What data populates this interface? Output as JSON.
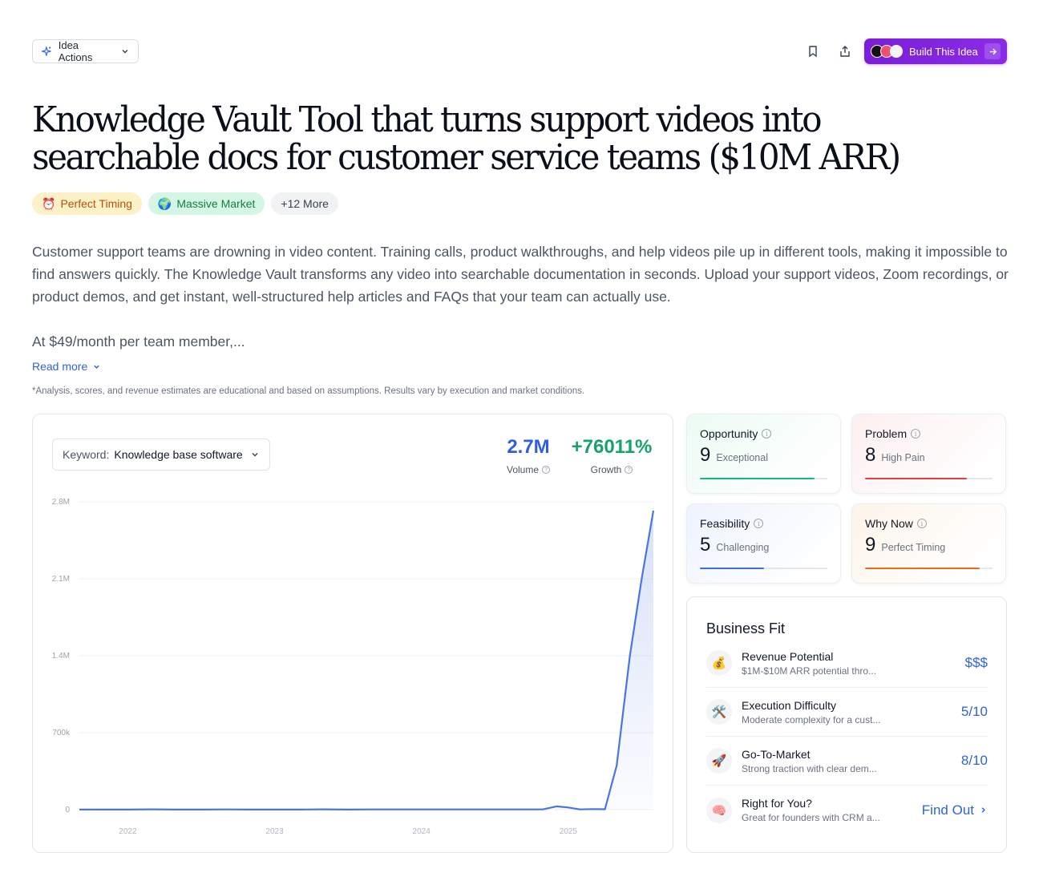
{
  "header": {
    "idea_actions_label": "Idea Actions",
    "build_button_label": "Build This Idea"
  },
  "idea": {
    "title": "Knowledge Vault Tool that turns support videos into searchable docs for customer service teams ($10M ARR)",
    "tags": [
      {
        "emoji": "⏰",
        "label": "Perfect Timing"
      },
      {
        "emoji": "🌍",
        "label": "Massive Market"
      },
      {
        "label": "+12 More"
      }
    ],
    "description": "Customer support teams are drowning in video content. Training calls, product walkthroughs, and help videos pile up in different tools, making it impossible to find answers quickly. The Knowledge Vault transforms any video into searchable documentation in seconds. Upload your support videos, Zoom recordings, or product demos, and get instant, well-structured help articles and FAQs that your team can actually use.",
    "description_cont": "At $49/month per team member,...",
    "read_more_label": "Read more",
    "disclaimer": "*Analysis, scores, and revenue estimates are educational and based on assumptions. Results vary by execution and market conditions."
  },
  "trend": {
    "keyword_label": "Keyword:",
    "keyword_value": "Knowledge base software",
    "volume_value": "2.7M",
    "volume_label": "Volume",
    "growth_value": "+76011%",
    "growth_label": "Growth",
    "colors": {
      "volume": "#2f5fe0",
      "growth": "#16a36a",
      "line": "#4a74e4"
    }
  },
  "chart_data": {
    "type": "area",
    "y_tick_labels": [
      "0",
      "700k",
      "1.4M",
      "2.1M",
      "2.8M"
    ],
    "y_ticks": [
      0,
      700000,
      1400000,
      2100000,
      2800000
    ],
    "ylim": [
      0,
      2800000
    ],
    "x_tick_labels": [
      "2022",
      "2023",
      "2024",
      "2025"
    ],
    "x_ticks": [
      2022,
      2023,
      2024,
      2025
    ],
    "xlim": [
      2021.67,
      2025.58
    ],
    "x": [
      2021.67,
      2021.83,
      2022.0,
      2022.17,
      2022.33,
      2022.5,
      2022.67,
      2022.83,
      2023.0,
      2023.17,
      2023.33,
      2023.5,
      2023.67,
      2023.83,
      2024.0,
      2024.17,
      2024.33,
      2024.5,
      2024.67,
      2024.75,
      2024.83,
      2024.92,
      2025.0,
      2025.08,
      2025.17,
      2025.25,
      2025.33,
      2025.42,
      2025.5,
      2025.58
    ],
    "values": [
      1000,
      1000,
      1000,
      3000,
      1000,
      1000,
      2000,
      1000,
      1000,
      1000,
      3000,
      1000,
      2000,
      2000,
      2000,
      2000,
      2000,
      2000,
      2000,
      2000,
      3000,
      30000,
      20000,
      2000,
      5000,
      4000,
      400000,
      1400000,
      2100000,
      2720000
    ]
  },
  "scores": [
    {
      "name": "Opportunity",
      "value": "9",
      "label": "Exceptional",
      "fraction": 0.9,
      "color": "#10b981",
      "bg": "#ecfbf3"
    },
    {
      "name": "Problem",
      "value": "8",
      "label": "High Pain",
      "fraction": 0.8,
      "color": "#e53e3e",
      "bg": "#fdeff0"
    },
    {
      "name": "Feasibility",
      "value": "5",
      "label": "Challenging",
      "fraction": 0.5,
      "color": "#3b6fe0",
      "bg": "#eef3fe"
    },
    {
      "name": "Why Now",
      "value": "9",
      "label": "Perfect Timing",
      "fraction": 0.9,
      "color": "#ea6c1b",
      "bg": "#fef4ea"
    }
  ],
  "business_fit": {
    "title": "Business Fit",
    "items": [
      {
        "emoji": "💰",
        "name": "Revenue Potential",
        "desc": "$1M-$10M ARR potential thro...",
        "value": "$$$"
      },
      {
        "emoji": "🛠️",
        "name": "Execution Difficulty",
        "desc": "Moderate complexity for a cust...",
        "value": "5/10"
      },
      {
        "emoji": "🚀",
        "name": "Go-To-Market",
        "desc": "Strong traction with clear dem...",
        "value": "8/10"
      },
      {
        "emoji": "🧠",
        "name": "Right for You?",
        "desc": "Great for founders with CRM a...",
        "value": "Find Out"
      }
    ]
  }
}
